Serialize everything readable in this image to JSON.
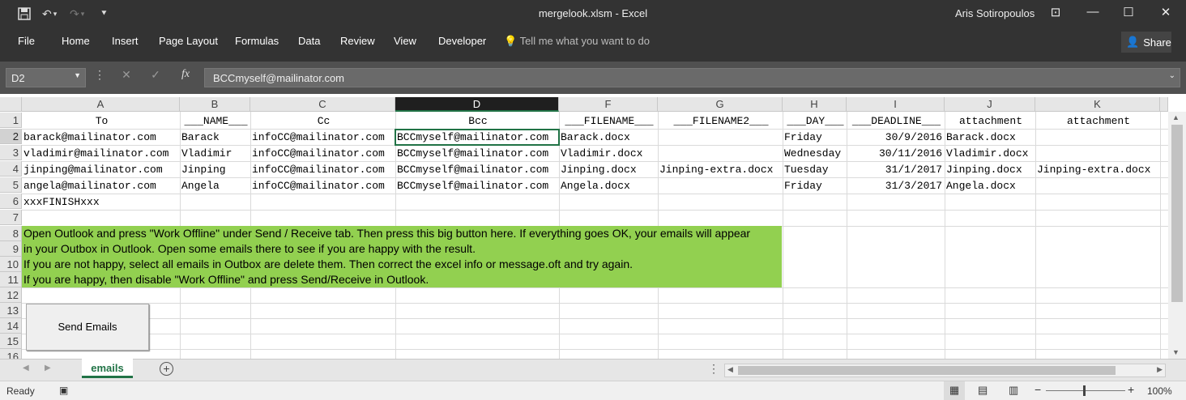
{
  "window": {
    "title": "mergelook.xlsm - Excel",
    "user": "Aris Sotiropoulos"
  },
  "menu": [
    "File",
    "Home",
    "Insert",
    "Page Layout",
    "Formulas",
    "Data",
    "Review",
    "View",
    "Developer"
  ],
  "tell_me": "Tell me what you want to do",
  "share": "Share",
  "name_box": "D2",
  "formula_value": "BCCmyself@mailinator.com",
  "columns": [
    "A",
    "B",
    "C",
    "D",
    "F",
    "G",
    "H",
    "I",
    "J",
    "K"
  ],
  "rows": [
    "1",
    "2",
    "3",
    "4",
    "5",
    "6",
    "7",
    "8",
    "9",
    "10",
    "11",
    "12",
    "13",
    "14",
    "15",
    "16"
  ],
  "headers": [
    "To",
    "___NAME___",
    "Cc",
    "Bcc",
    "___FILENAME___",
    "___FILENAME2___",
    "___DAY___",
    "___DEADLINE___",
    "attachment",
    "attachment"
  ],
  "data": [
    [
      "barack@mailinator.com",
      "Barack",
      "infoCC@mailinator.com",
      "BCCmyself@mailinator.com",
      "Barack.docx",
      "",
      "Friday",
      "30/9/2016",
      "Barack.docx",
      ""
    ],
    [
      "vladimir@mailinator.com",
      "Vladimir",
      "infoCC@mailinator.com",
      "BCCmyself@mailinator.com",
      "Vladimir.docx",
      "",
      "Wednesday",
      "30/11/2016",
      "Vladimir.docx",
      ""
    ],
    [
      "jinping@mailinator.com",
      "Jinping",
      "infoCC@mailinator.com",
      "BCCmyself@mailinator.com",
      "Jinping.docx",
      "Jinping-extra.docx",
      "Tuesday",
      "31/1/2017",
      "Jinping.docx",
      "Jinping-extra.docx"
    ],
    [
      "angela@mailinator.com",
      "Angela",
      "infoCC@mailinator.com",
      "BCCmyself@mailinator.com",
      "Angela.docx",
      "",
      "Friday",
      "31/3/2017",
      "Angela.docx",
      ""
    ]
  ],
  "finish_marker": "xxxFINISHxxx",
  "instructions": [
    "Open Outlook and press \"Work Offline\" under Send / Receive tab. Then press this big button here. If everything goes OK, your emails will appear",
    "in your Outbox in Outlook. Open some emails there to see if you are happy with the result.",
    "If you are not happy, select all emails in Outbox are delete them. Then correct the excel info or message.oft and try again.",
    "If you are happy, then disable \"Work Offline\" and press Send/Receive in Outlook."
  ],
  "send_button": "Send Emails",
  "sheet_tab": "emails",
  "status": {
    "ready": "Ready",
    "zoom": "100%"
  },
  "colors": {
    "excel_green": "#217346",
    "instruction_fill": "#92d050",
    "title_bg": "#333333"
  }
}
